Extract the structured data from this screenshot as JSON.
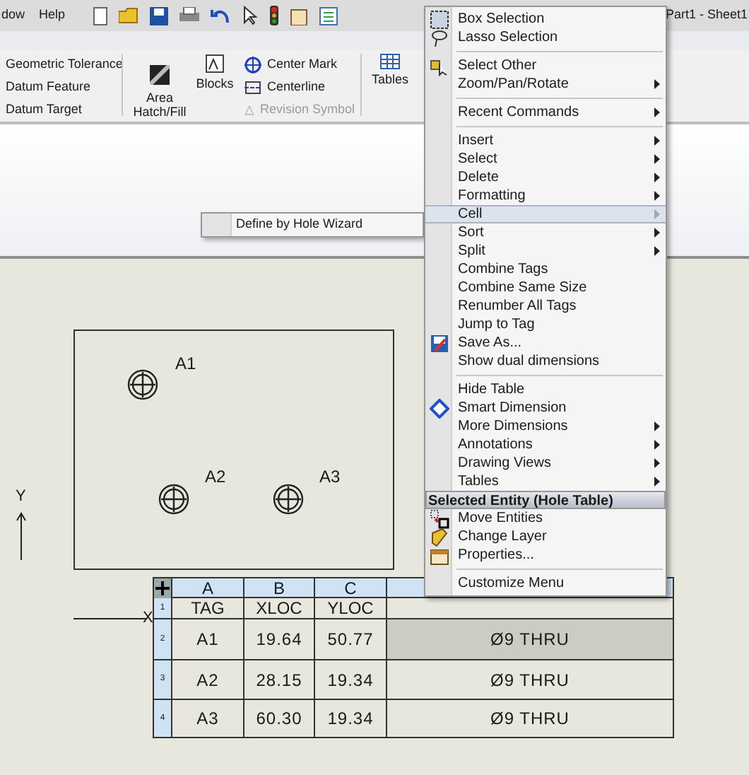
{
  "menu_bar": [
    "dow",
    "Help"
  ],
  "window": {
    "title": "Part1 - Sheet1"
  },
  "ribbon": [
    {
      "kind": "small",
      "label": "Geometric Tolerance",
      "disabled": false
    },
    {
      "kind": "small",
      "label": "Datum Feature",
      "disabled": false
    },
    {
      "kind": "small",
      "label": "Datum Target",
      "disabled": false
    },
    {
      "kind": "large",
      "label": "Area Hatch/Fill",
      "disabled": false
    },
    {
      "kind": "large",
      "label": "Blocks",
      "disabled": false
    },
    {
      "kind": "small",
      "label": "Center Mark",
      "disabled": false
    },
    {
      "kind": "small",
      "label": "Centerline",
      "disabled": false
    },
    {
      "kind": "small",
      "label": "Revision Symbol",
      "disabled": true
    },
    {
      "kind": "large",
      "label": "Tables",
      "disabled": false
    }
  ],
  "submenu": {
    "items": [
      "Define by Hole Wizard"
    ]
  },
  "context_menu": [
    {
      "kind": "item",
      "label": "Box Selection",
      "submenu": false,
      "selected": false
    },
    {
      "kind": "item",
      "label": "Lasso Selection",
      "submenu": false,
      "selected": false
    },
    {
      "kind": "separator"
    },
    {
      "kind": "item",
      "label": "Select Other",
      "submenu": false,
      "selected": false
    },
    {
      "kind": "item",
      "label": "Zoom/Pan/Rotate",
      "submenu": true,
      "selected": false
    },
    {
      "kind": "separator"
    },
    {
      "kind": "item",
      "label": "Recent Commands",
      "submenu": true,
      "selected": false
    },
    {
      "kind": "separator"
    },
    {
      "kind": "item",
      "label": "Insert",
      "submenu": true,
      "selected": false
    },
    {
      "kind": "item",
      "label": "Select",
      "submenu": true,
      "selected": false
    },
    {
      "kind": "item",
      "label": "Delete",
      "submenu": true,
      "selected": false
    },
    {
      "kind": "item",
      "label": "Formatting",
      "submenu": true,
      "selected": false
    },
    {
      "kind": "item",
      "label": "Cell",
      "submenu": true,
      "selected": true
    },
    {
      "kind": "item",
      "label": "Sort",
      "submenu": true,
      "selected": false
    },
    {
      "kind": "item",
      "label": "Split",
      "submenu": true,
      "selected": false
    },
    {
      "kind": "item",
      "label": "Combine Tags",
      "submenu": false,
      "selected": false
    },
    {
      "kind": "item",
      "label": "Combine Same Size",
      "submenu": false,
      "selected": false
    },
    {
      "kind": "item",
      "label": "Renumber All Tags",
      "submenu": false,
      "selected": false
    },
    {
      "kind": "item",
      "label": "Jump to Tag",
      "submenu": false,
      "selected": false
    },
    {
      "kind": "item",
      "label": "Save As...",
      "submenu": false,
      "selected": false
    },
    {
      "kind": "item",
      "label": "Show dual dimensions",
      "submenu": false,
      "selected": false
    },
    {
      "kind": "separator"
    },
    {
      "kind": "item",
      "label": "Hide Table",
      "submenu": false,
      "selected": false
    },
    {
      "kind": "item",
      "label": "Smart Dimension",
      "submenu": false,
      "selected": false
    },
    {
      "kind": "item",
      "label": "More Dimensions",
      "submenu": true,
      "selected": false
    },
    {
      "kind": "item",
      "label": "Annotations",
      "submenu": true,
      "selected": false
    },
    {
      "kind": "item",
      "label": "Drawing Views",
      "submenu": true,
      "selected": false
    },
    {
      "kind": "item",
      "label": "Tables",
      "submenu": true,
      "selected": false
    },
    {
      "kind": "header",
      "label": "Selected Entity (Hole Table)"
    },
    {
      "kind": "item",
      "label": "Move Entities",
      "submenu": false,
      "selected": false
    },
    {
      "kind": "item",
      "label": "Change Layer",
      "submenu": false,
      "selected": false
    },
    {
      "kind": "item",
      "label": "Properties...",
      "submenu": false,
      "selected": false
    },
    {
      "kind": "separator"
    },
    {
      "kind": "item",
      "label": "Customize Menu",
      "submenu": false,
      "selected": false
    }
  ],
  "drawing": {
    "holes": [
      "A1",
      "A2",
      "A3"
    ],
    "axes": [
      "Y",
      "X"
    ]
  },
  "hole_table": {
    "columns": [
      "A",
      "B",
      "C"
    ],
    "rows": [
      {
        "number": "1",
        "cells": [
          "TAG",
          "XLOC",
          "YLOC"
        ],
        "selected": false
      },
      {
        "number": "2",
        "cells": [
          "A1",
          "19.64",
          "50.77",
          "Ø9 THRU"
        ],
        "selected": true
      },
      {
        "number": "3",
        "cells": [
          "A2",
          "28.15",
          "19.34",
          "Ø9 THRU"
        ],
        "selected": false
      },
      {
        "number": "4",
        "cells": [
          "A3",
          "60.30",
          "19.34",
          "Ø9 THRU"
        ],
        "selected": false
      }
    ]
  }
}
